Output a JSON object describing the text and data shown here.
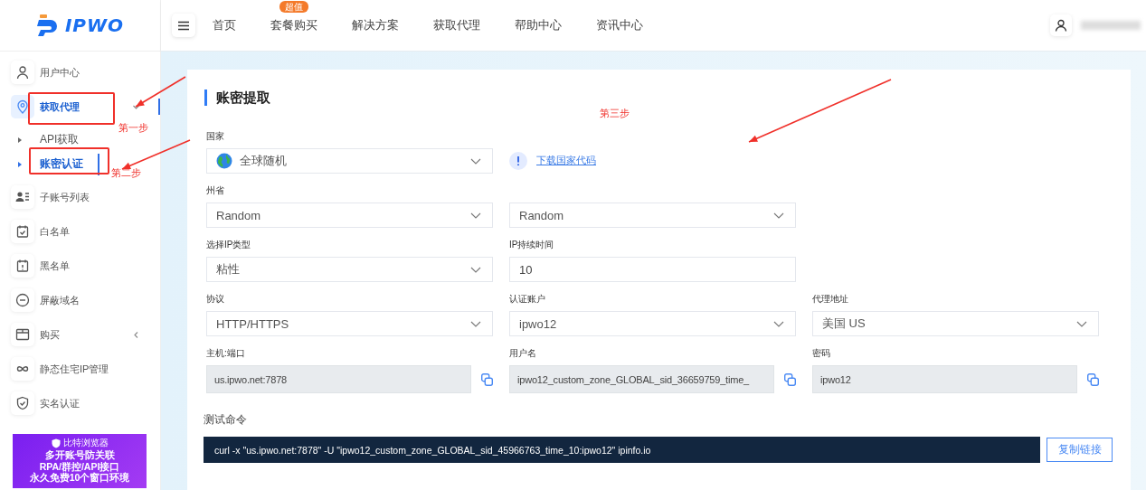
{
  "logo": {
    "text": "IPWO"
  },
  "header": {
    "nav": [
      {
        "label": "首页"
      },
      {
        "label": "套餐购买",
        "badge": "超值"
      },
      {
        "label": "解决方案"
      },
      {
        "label": "获取代理"
      },
      {
        "label": "帮助中心"
      },
      {
        "label": "资讯中心"
      }
    ]
  },
  "sidebar": {
    "items": [
      {
        "label": "用户中心",
        "selected": false
      },
      {
        "label": "获取代理",
        "selected": true,
        "expanded": true,
        "children": [
          {
            "label": "API获取",
            "selected": false
          },
          {
            "label": "账密认证",
            "selected": true
          }
        ]
      },
      {
        "label": "子账号列表",
        "selected": false
      },
      {
        "label": "白名单",
        "selected": false
      },
      {
        "label": "黑名单",
        "selected": false
      },
      {
        "label": "屏蔽域名",
        "selected": false
      },
      {
        "label": "购买",
        "selected": false,
        "expanded": false
      },
      {
        "label": "静态住宅IP管理",
        "selected": false
      },
      {
        "label": "实名认证",
        "selected": false
      }
    ]
  },
  "banner": {
    "brand": "比特浏览器",
    "lines": [
      "多开账号防关联",
      "RPA/群控/API接口",
      "永久免费10个窗口环境"
    ]
  },
  "form": {
    "title": "账密提取",
    "rows": [
      {
        "cells": [
          {
            "kind": "country-select",
            "label": "国家",
            "value": "全球随机"
          },
          {
            "kind": "link",
            "text": "下载国家代码"
          }
        ]
      },
      {
        "cells": [
          {
            "kind": "select",
            "label": "州省",
            "value": "Random"
          },
          {
            "kind": "select",
            "value": "Random"
          }
        ]
      },
      {
        "cells": [
          {
            "kind": "select",
            "label": "选择IP类型",
            "value": "粘性"
          },
          {
            "kind": "input",
            "label": "IP持续时间",
            "value": "10"
          }
        ]
      },
      {
        "cells": [
          {
            "kind": "select",
            "label": "协议",
            "value": "HTTP/HTTPS"
          },
          {
            "kind": "select",
            "label": "认证账户",
            "value": "ipwo12"
          },
          {
            "kind": "select",
            "label": "代理地址",
            "value": "美国 US"
          }
        ]
      },
      {
        "cells": [
          {
            "kind": "readonly",
            "label": "主机:端口",
            "value": "us.ipwo.net:7878"
          },
          {
            "kind": "readonly",
            "label": "用户名",
            "value": "ipwo12_custom_zone_GLOBAL_sid_36659759_time_"
          },
          {
            "kind": "readonly",
            "label": "密码",
            "value": "ipwo12"
          }
        ]
      }
    ],
    "test": {
      "label": "测试命令",
      "command": "curl -x \"us.ipwo.net:7878\" -U \"ipwo12_custom_zone_GLOBAL_sid_45966763_time_10:ipwo12\" ipinfo.io",
      "button": "复制链接"
    }
  },
  "annotations": {
    "steps": [
      "第一步",
      "第二步",
      "第三步"
    ]
  }
}
